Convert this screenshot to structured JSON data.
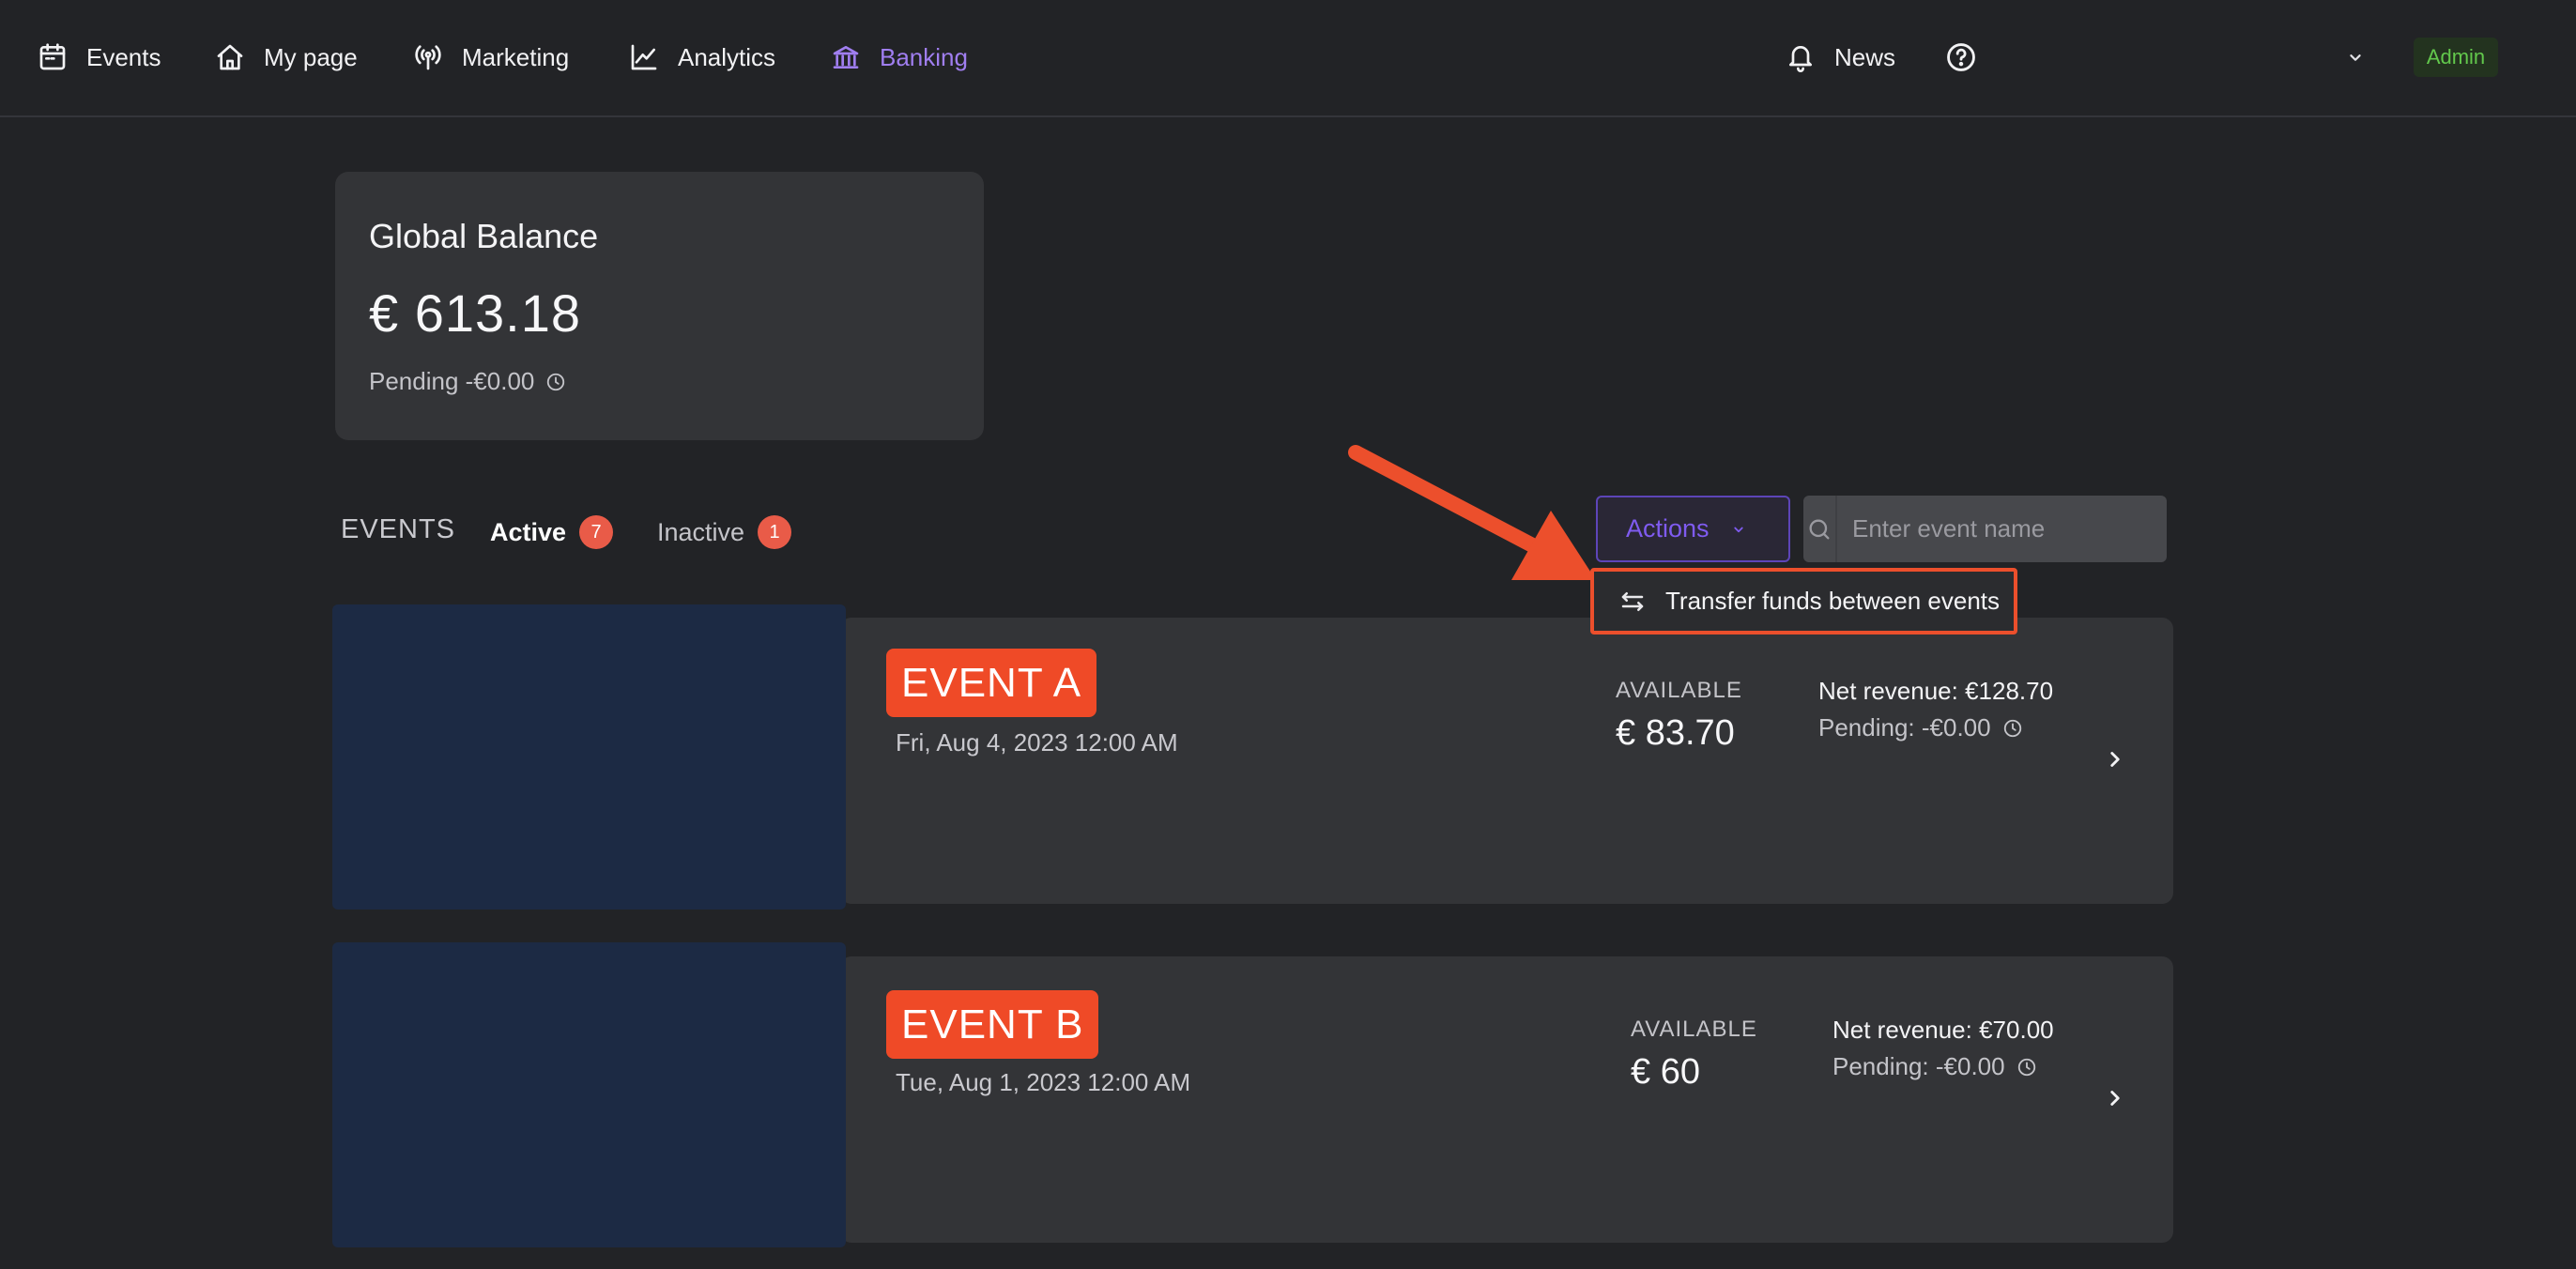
{
  "nav": {
    "items": [
      {
        "label": "Events",
        "icon": "calendar-icon"
      },
      {
        "label": "My page",
        "icon": "home-icon"
      },
      {
        "label": "Marketing",
        "icon": "broadcast-icon"
      },
      {
        "label": "Analytics",
        "icon": "chart-line-icon"
      },
      {
        "label": "Banking",
        "icon": "bank-icon",
        "active": true
      }
    ],
    "news_label": "News",
    "help_icon": "help-icon",
    "account_chevron_icon": "chevron-down-icon",
    "role_badge": "Admin"
  },
  "balance": {
    "title": "Global Balance",
    "amount": "€ 613.18",
    "pending": "Pending -€0.00"
  },
  "events_section": {
    "heading": "EVENTS",
    "tabs": [
      {
        "label": "Active",
        "count": "7",
        "active": true
      },
      {
        "label": "Inactive",
        "count": "1",
        "active": false
      }
    ],
    "actions_label": "Actions",
    "search_placeholder": "Enter event name",
    "dropdown": {
      "transfer_label": "Transfer funds between events",
      "icon": "transfer-arrows-icon"
    }
  },
  "events": [
    {
      "name": "EVENT A",
      "date": "Fri, Aug 4, 2023 12:00 AM",
      "available_label": "AVAILABLE",
      "available": "€ 83.70",
      "net_revenue": "Net revenue: €128.70",
      "pending": "Pending: -€0.00"
    },
    {
      "name": "EVENT B",
      "date": "Tue, Aug 1, 2023 12:00 AM",
      "available_label": "AVAILABLE",
      "available": "€ 60",
      "net_revenue": "Net revenue: €70.00",
      "pending": "Pending: -€0.00"
    }
  ],
  "colors": {
    "background": "#222326",
    "card": "#333437",
    "accent_purple": "#7f5bf0",
    "highlight_orange": "#ec4f2c",
    "badge_red": "#e95b48",
    "admin_green": "#62c84c"
  }
}
